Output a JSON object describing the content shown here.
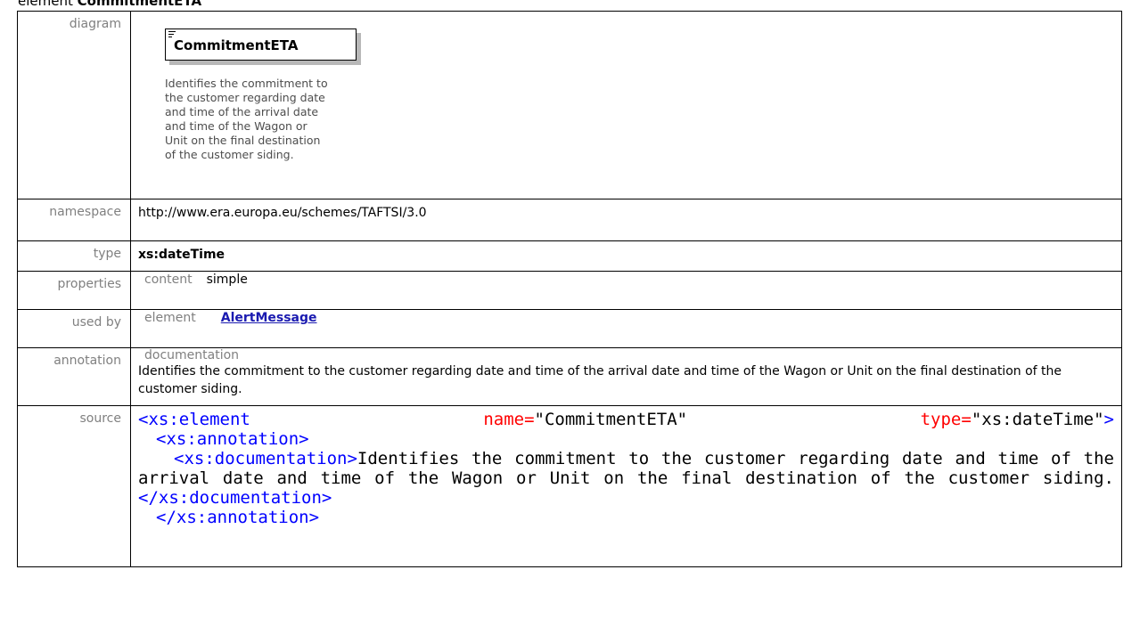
{
  "heading": {
    "prefix": "element",
    "name": "CommitmentETA"
  },
  "labels": {
    "diagram": "diagram",
    "namespace": "namespace",
    "type": "type",
    "properties": "properties",
    "used_by": "used by",
    "annotation": "annotation",
    "source": "source"
  },
  "diagram": {
    "element_name": "CommitmentETA",
    "doc_lines": [
      "Identifies the commitment to",
      "the customer regarding date",
      "and time of the arrival date",
      "and time of the Wagon or",
      "Unit on the final destination",
      "of the customer siding."
    ]
  },
  "namespace": "http://www.era.europa.eu/schemes/TAFTSI/3.0",
  "type": "xs:dateTime",
  "properties": {
    "key": "content",
    "value": "simple"
  },
  "used_by": {
    "kind": "element",
    "link": "AlertMessage"
  },
  "annotation": {
    "label": "documentation",
    "text": "Identifies the commitment to the customer regarding date and time of the arrival date and time of the Wagon or Unit on the final destination of the customer siding."
  },
  "source": {
    "open_tag": "<xs:element",
    "name_attr": "name=",
    "name_value": "\"CommitmentETA\"",
    "type_attr": "type=",
    "type_value": "\"xs:dateTime\"",
    "open_close": ">",
    "annotation_open": "<xs:annotation>",
    "documentation_open": "<xs:documentation>",
    "documentation_text": "Identifies the commitment to the customer regarding date and time of the arrival date and time of the Wagon or Unit on the final destination of the customer siding.",
    "documentation_close": "</xs:documentation>",
    "annotation_close": "</xs:annotation>"
  }
}
